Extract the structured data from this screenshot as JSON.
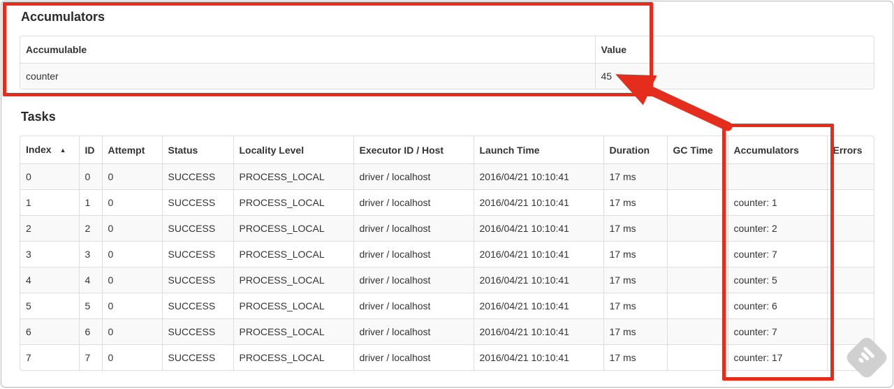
{
  "accumulators_section": {
    "title": "Accumulators"
  },
  "tasks_section": {
    "title": "Tasks"
  },
  "tables": {
    "accumulators": {
      "headers": [
        "Accumulable",
        "Value"
      ],
      "rows": [
        [
          "counter",
          "45"
        ]
      ]
    },
    "tasks": {
      "headers": [
        "Index",
        "ID",
        "Attempt",
        "Status",
        "Locality Level",
        "Executor ID / Host",
        "Launch Time",
        "Duration",
        "GC Time",
        "Accumulators",
        "Errors"
      ],
      "sort_column": 0,
      "sort_icon": "▲",
      "rows": [
        [
          "0",
          "0",
          "0",
          "SUCCESS",
          "PROCESS_LOCAL",
          "driver / localhost",
          "2016/04/21 10:10:41",
          "17 ms",
          "",
          "",
          ""
        ],
        [
          "1",
          "1",
          "0",
          "SUCCESS",
          "PROCESS_LOCAL",
          "driver / localhost",
          "2016/04/21 10:10:41",
          "17 ms",
          "",
          "counter: 1",
          ""
        ],
        [
          "2",
          "2",
          "0",
          "SUCCESS",
          "PROCESS_LOCAL",
          "driver / localhost",
          "2016/04/21 10:10:41",
          "17 ms",
          "",
          "counter: 2",
          ""
        ],
        [
          "3",
          "3",
          "0",
          "SUCCESS",
          "PROCESS_LOCAL",
          "driver / localhost",
          "2016/04/21 10:10:41",
          "17 ms",
          "",
          "counter: 7",
          ""
        ],
        [
          "4",
          "4",
          "0",
          "SUCCESS",
          "PROCESS_LOCAL",
          "driver / localhost",
          "2016/04/21 10:10:41",
          "17 ms",
          "",
          "counter: 5",
          ""
        ],
        [
          "5",
          "5",
          "0",
          "SUCCESS",
          "PROCESS_LOCAL",
          "driver / localhost",
          "2016/04/21 10:10:41",
          "17 ms",
          "",
          "counter: 6",
          ""
        ],
        [
          "6",
          "6",
          "0",
          "SUCCESS",
          "PROCESS_LOCAL",
          "driver / localhost",
          "2016/04/21 10:10:41",
          "17 ms",
          "",
          "counter: 7",
          ""
        ],
        [
          "7",
          "7",
          "0",
          "SUCCESS",
          "PROCESS_LOCAL",
          "driver / localhost",
          "2016/04/21 10:10:41",
          "17 ms",
          "",
          "counter: 17",
          ""
        ]
      ]
    }
  },
  "annotations": {
    "color": "#e42d1c",
    "highlighted_value": "45",
    "highlighted_column": "Accumulators"
  }
}
